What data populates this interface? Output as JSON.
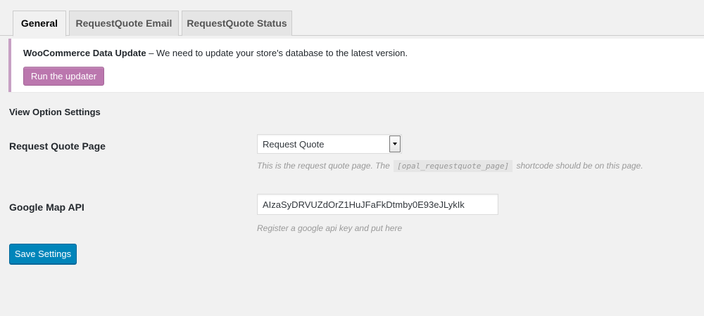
{
  "tabs": [
    {
      "label": "General",
      "active": true
    },
    {
      "label": "RequestQuote Email",
      "active": false
    },
    {
      "label": "RequestQuote Status",
      "active": false
    }
  ],
  "notice": {
    "title": "WooCommerce Data Update",
    "message": " – We need to update your store's database to the latest version.",
    "button_label": "Run the updater",
    "accent_color": "#bb77ae"
  },
  "form": {
    "section_title": "View Option Settings",
    "request_quote_page": {
      "label": "Request Quote Page",
      "selected": "Request Quote",
      "desc_before": "This is the request quote page. The",
      "desc_code": "[opal_requestquote_page]",
      "desc_after": "shortcode should be on this page."
    },
    "google_map_api": {
      "label": "Google Map API",
      "value": "AIzaSyDRVUZdOrZ1HuJFaFkDtmby0E93eJLykIk",
      "description": "Register a google api key and put here"
    },
    "save_label": "Save Settings",
    "primary_color": "#0085ba"
  }
}
